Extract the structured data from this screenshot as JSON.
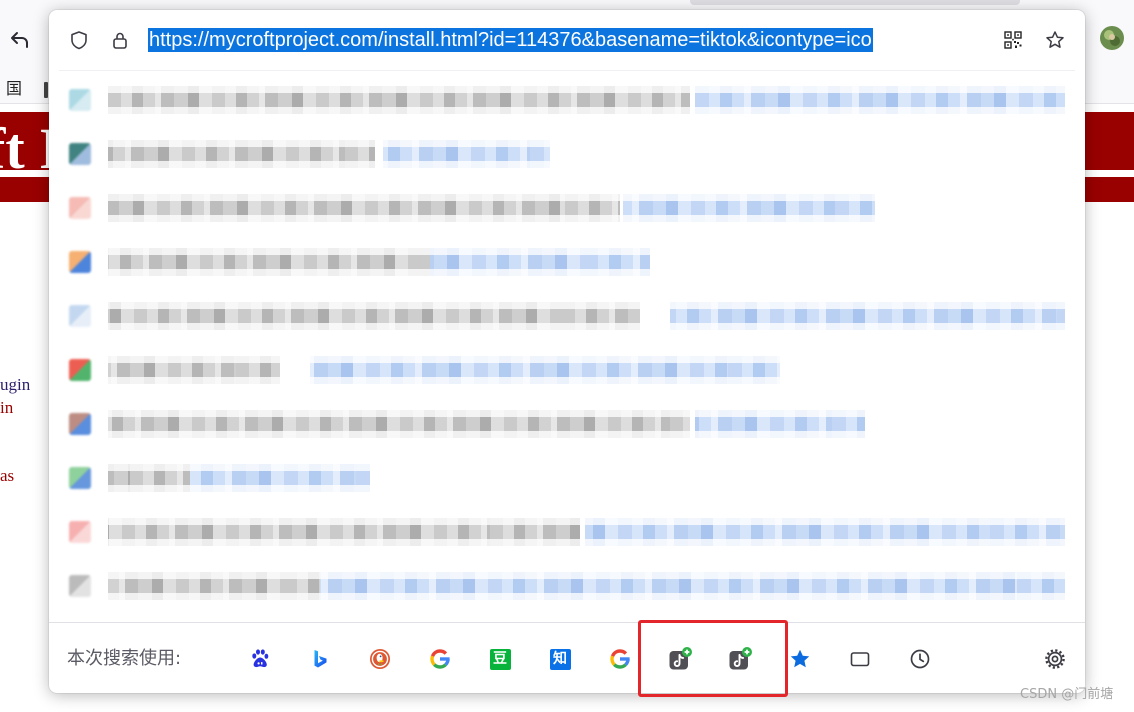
{
  "browser": {
    "back_icon": "back-arrow-icon",
    "avatar_icon": "profile-avatar-icon",
    "bookmark_label": "国"
  },
  "page": {
    "banner_text": "ft I",
    "banner_color": "#990000",
    "fragments": [
      "ugin",
      "in",
      "as"
    ]
  },
  "urlbar": {
    "url": "https://mycroftproject.com/install.html?id=114376&basename=tiktok&icontype=ico",
    "selection_color": "#0b74de",
    "left_icons": [
      "shield-icon",
      "lock-icon"
    ],
    "right_icons": [
      "qr-code-icon",
      "bookmark-star-icon"
    ]
  },
  "results": [
    {
      "favicon_colors": [
        "#9ed3e0",
        "#cfe8f0"
      ]
    },
    {
      "favicon_colors": [
        "#1f6e6a",
        "#8fb0d8"
      ]
    },
    {
      "favicon_colors": [
        "#f4b0a8",
        "#f8d2cc"
      ]
    },
    {
      "favicon_colors": [
        "#f4a35a",
        "#2f6fd6"
      ]
    },
    {
      "favicon_colors": [
        "#b9d2ee",
        "#e3ecf7"
      ]
    },
    {
      "favicon_colors": [
        "#ea4335",
        "#34a853"
      ]
    },
    {
      "favicon_colors": [
        "#b27a6e",
        "#3e7bd9"
      ]
    },
    {
      "favicon_colors": [
        "#7cc98b",
        "#4d86d8"
      ]
    },
    {
      "favicon_colors": [
        "#f5a3a3",
        "#fad2d2"
      ]
    },
    {
      "favicon_colors": [
        "#b0b0b0",
        "#dedede"
      ]
    }
  ],
  "footer": {
    "label": "本次搜索使用:",
    "engines": [
      "baidu-icon",
      "bing-icon",
      "duckduckgo-icon",
      "google-icon",
      "douban-icon",
      "zhihu-icon",
      "google-icon",
      "tiktok-add-icon",
      "tiktok-add-icon",
      "bookmarks-star-icon",
      "tabs-icon",
      "history-clock-icon"
    ],
    "douban_glyph": "豆",
    "zhihu_glyph": "知",
    "settings_icon": "gear-icon"
  },
  "highlight_color": "#e3262b",
  "watermark": "CSDN @门前塘"
}
